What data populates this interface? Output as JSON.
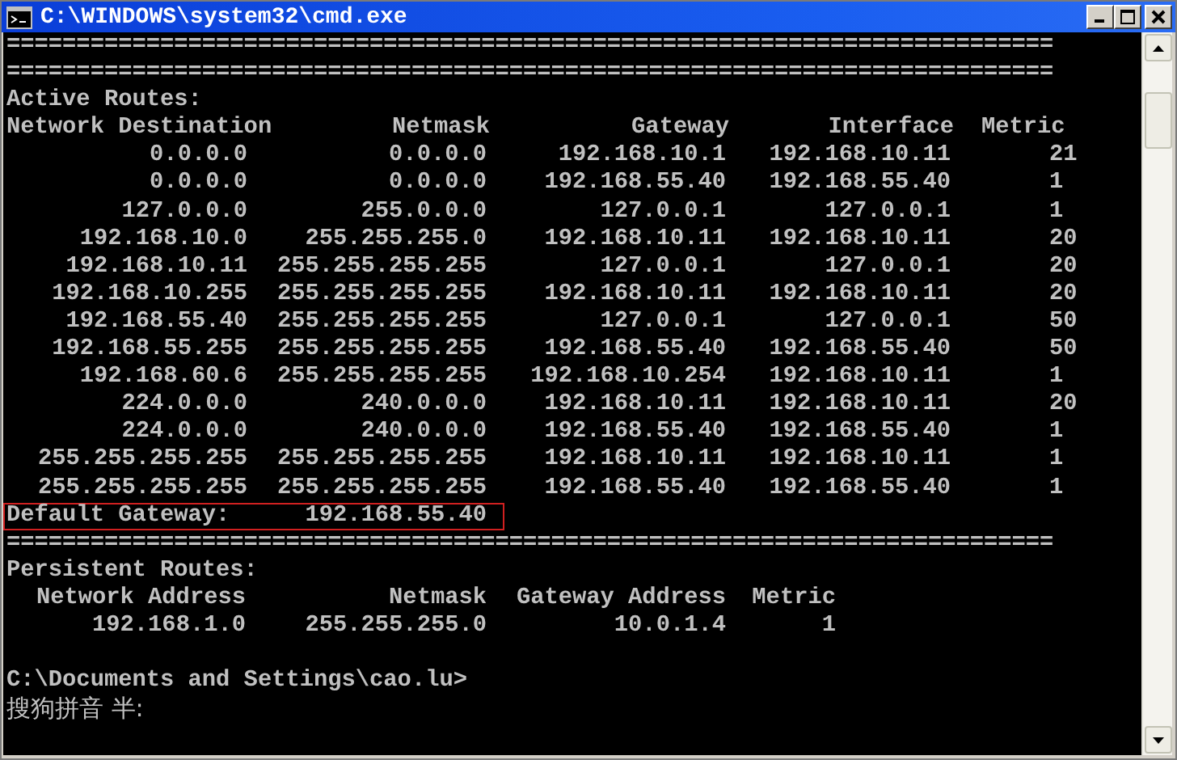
{
  "window": {
    "title": "C:\\WINDOWS\\system32\\cmd.exe"
  },
  "console": {
    "separators_top": [
      "===========================================================================",
      "==========================================================================="
    ],
    "active_routes": {
      "title": "Active Routes:",
      "columns": [
        "Network Destination",
        "Netmask",
        "Gateway",
        "Interface",
        "Metric"
      ],
      "rows": [
        [
          "0.0.0.0",
          "0.0.0.0",
          "192.168.10.1",
          "192.168.10.11",
          "21"
        ],
        [
          "0.0.0.0",
          "0.0.0.0",
          "192.168.55.40",
          "192.168.55.40",
          "1"
        ],
        [
          "127.0.0.0",
          "255.0.0.0",
          "127.0.0.1",
          "127.0.0.1",
          "1"
        ],
        [
          "192.168.10.0",
          "255.255.255.0",
          "192.168.10.11",
          "192.168.10.11",
          "20"
        ],
        [
          "192.168.10.11",
          "255.255.255.255",
          "127.0.0.1",
          "127.0.0.1",
          "20"
        ],
        [
          "192.168.10.255",
          "255.255.255.255",
          "192.168.10.11",
          "192.168.10.11",
          "20"
        ],
        [
          "192.168.55.40",
          "255.255.255.255",
          "127.0.0.1",
          "127.0.0.1",
          "50"
        ],
        [
          "192.168.55.255",
          "255.255.255.255",
          "192.168.55.40",
          "192.168.55.40",
          "50"
        ],
        [
          "192.168.60.6",
          "255.255.255.255",
          "192.168.10.254",
          "192.168.10.11",
          "1"
        ],
        [
          "224.0.0.0",
          "240.0.0.0",
          "192.168.10.11",
          "192.168.10.11",
          "20"
        ],
        [
          "224.0.0.0",
          "240.0.0.0",
          "192.168.55.40",
          "192.168.55.40",
          "1"
        ],
        [
          "255.255.255.255",
          "255.255.255.255",
          "192.168.10.11",
          "192.168.10.11",
          "1"
        ],
        [
          "255.255.255.255",
          "255.255.255.255",
          "192.168.55.40",
          "192.168.55.40",
          "1"
        ]
      ]
    },
    "default_gateway": {
      "label": "Default Gateway:",
      "value": "192.168.55.40",
      "highlighted": true
    },
    "separator_bottom": "===========================================================================",
    "persistent_routes": {
      "title": "Persistent Routes:",
      "columns": [
        "Network Address",
        "Netmask",
        "Gateway Address",
        "Metric"
      ],
      "rows": [
        [
          "192.168.1.0",
          "255.255.255.0",
          "10.0.1.4",
          "1"
        ]
      ]
    },
    "prompt": "C:\\Documents and Settings\\cao.lu>",
    "ime_status": "搜狗拼音 半:"
  }
}
